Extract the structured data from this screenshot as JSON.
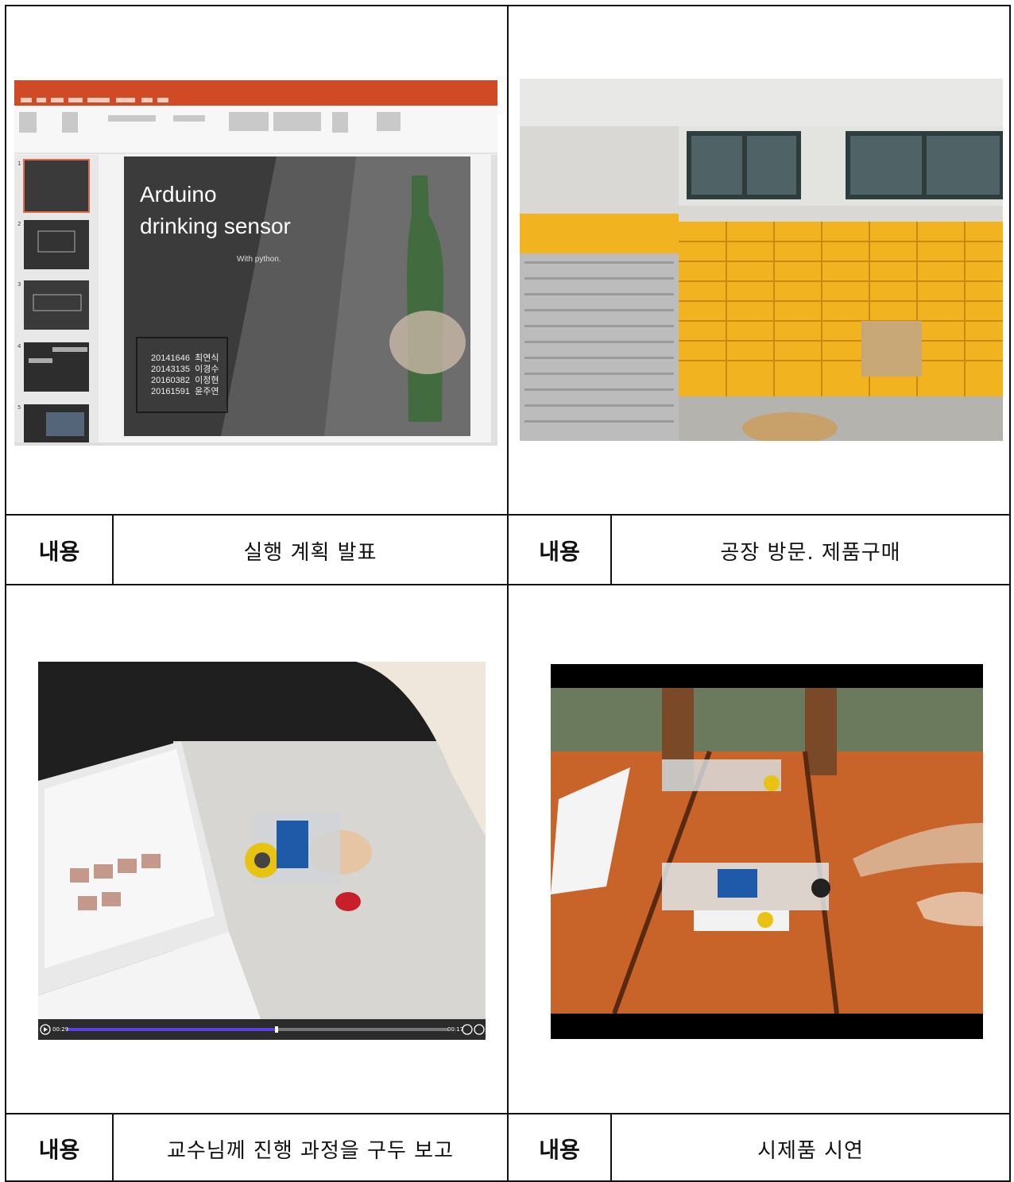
{
  "cells": [
    {
      "label": "내용",
      "content": "실행 계획 발표",
      "slide": {
        "title_line1": "Arduino",
        "title_line2": "drinking sensor",
        "subtitle": "With python.",
        "members": [
          {
            "id": "20141646",
            "name": "최연식"
          },
          {
            "id": "20143135",
            "name": "이경수"
          },
          {
            "id": "20160382",
            "name": "이정현"
          },
          {
            "id": "20161591",
            "name": "윤주연"
          }
        ],
        "thumb_numbers": [
          "1",
          "2",
          "3",
          "4",
          "5"
        ]
      }
    },
    {
      "label": "내용",
      "content": "공장 방문. 제품구매"
    },
    {
      "label": "내용",
      "content": "교수님께 진행 과정을 구두 보고",
      "video": {
        "elapsed": "00:29",
        "remaining": "00:17",
        "progress": 0.55
      }
    },
    {
      "label": "내용",
      "content": "시제품 시연"
    }
  ],
  "colors": {
    "ppt_orange": "#d04a26",
    "bin_yellow": "#f2b321",
    "table_orange": "#c8632a",
    "progress_purple": "#5a3fe0"
  }
}
